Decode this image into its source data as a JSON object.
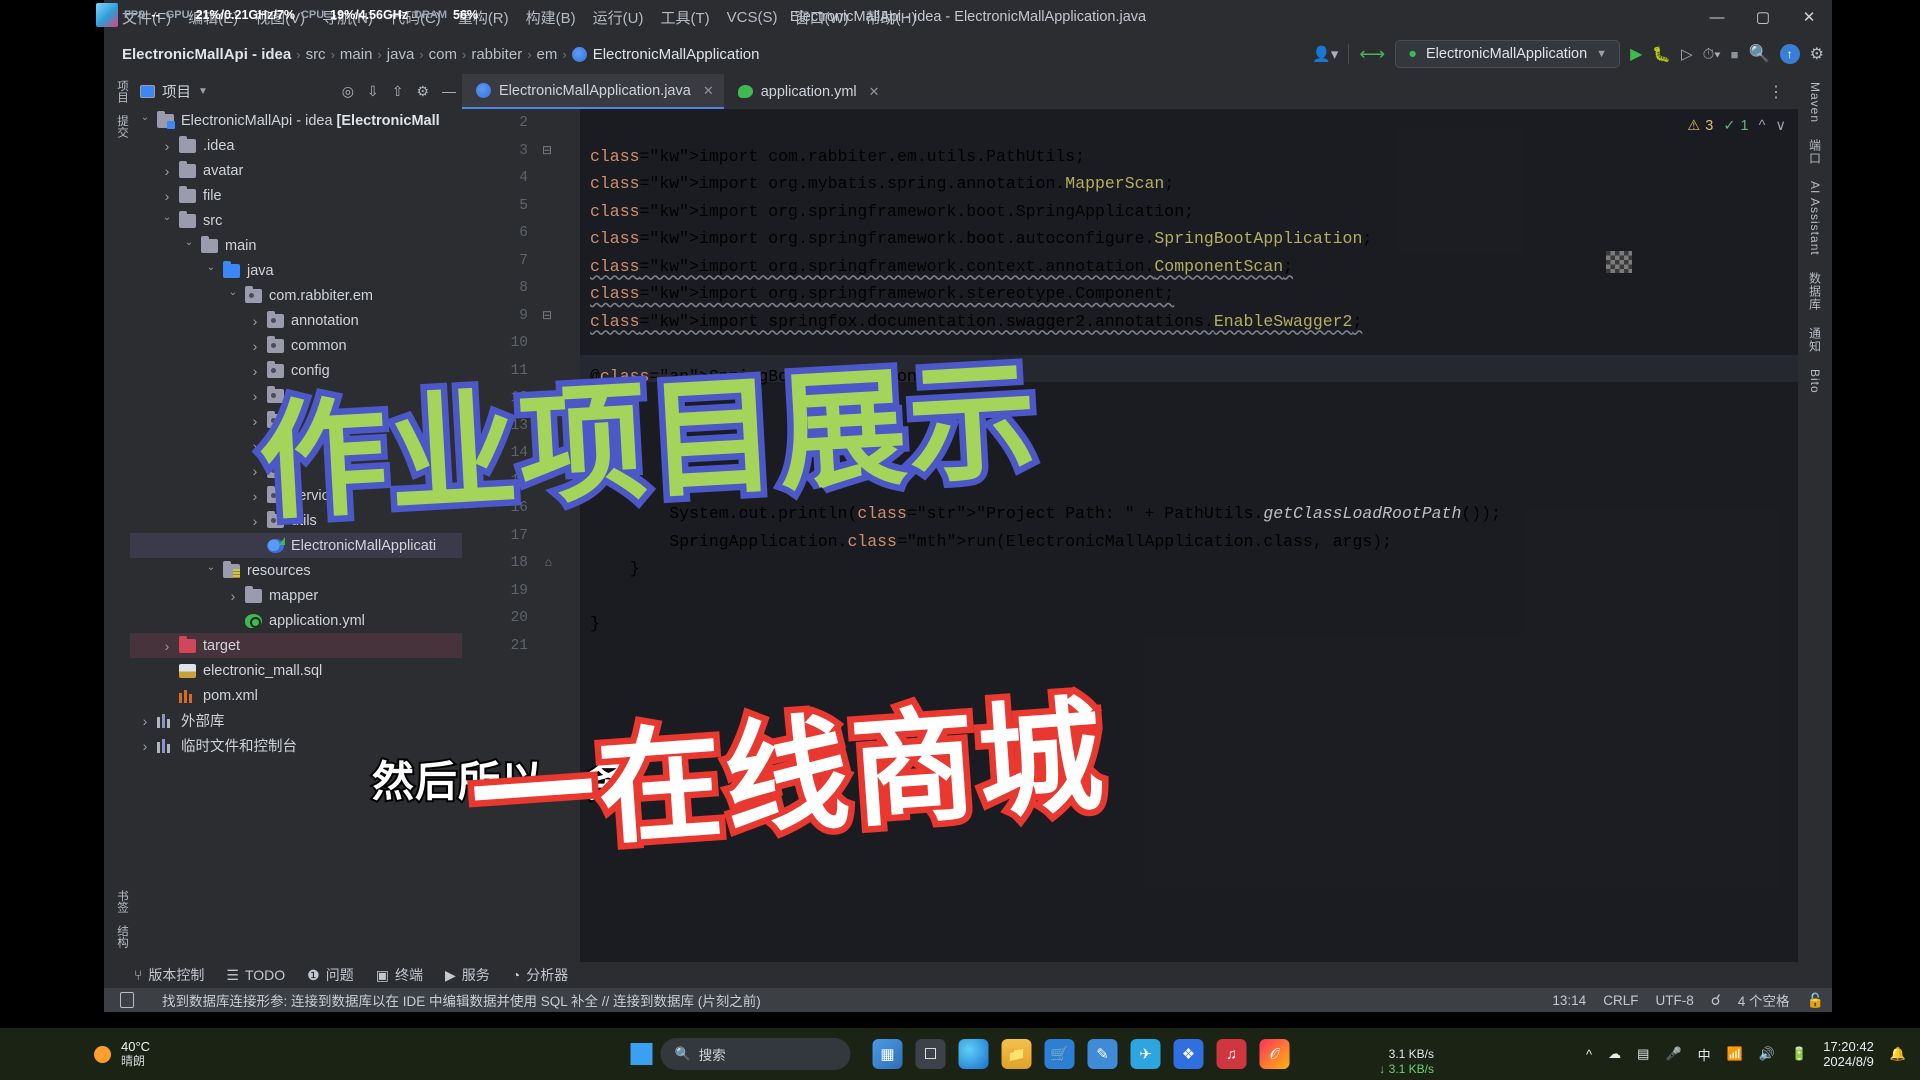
{
  "window": {
    "title": "ElectronicMallApi - idea - ElectronicMallApplication.java",
    "minimize": "—",
    "maximize": "▢",
    "close": "✕"
  },
  "fps_overlay": {
    "fps_label": "FPS",
    "fps_value": "--",
    "gpu_label": "GPU",
    "gpu_value": "21%/0.21GHz/7%",
    "cpu_label": "CPU",
    "cpu_value": "19%/4.56GHz",
    "dram_label": "DRAM",
    "dram_value": "56%"
  },
  "menu": [
    {
      "label": "文件(F)"
    },
    {
      "label": "编辑(E)"
    },
    {
      "label": "视图(V)"
    },
    {
      "label": "导航(N)"
    },
    {
      "label": "代码(C)"
    },
    {
      "label": "重构(R)"
    },
    {
      "label": "构建(B)"
    },
    {
      "label": "运行(U)"
    },
    {
      "label": "工具(T)"
    },
    {
      "label": "VCS(S)"
    },
    {
      "label": "窗口(W)"
    },
    {
      "label": "帮助(H)"
    }
  ],
  "breadcrumb": {
    "project": "ElectronicMallApi - idea",
    "parts": [
      "src",
      "main",
      "java",
      "com",
      "rabbiter",
      "em"
    ],
    "file": "ElectronicMallApplication"
  },
  "navbar": {
    "run_config": "ElectronicMallApplication",
    "run_tooltip": "运行",
    "debug_tooltip": "调试",
    "search_tooltip": "搜索",
    "settings_tooltip": "设置"
  },
  "left_strip": [
    {
      "label": "项目"
    },
    {
      "label": "提交"
    }
  ],
  "right_strip": [
    {
      "label": "Maven"
    },
    {
      "label": "端口"
    },
    {
      "label": "AI Assistant"
    },
    {
      "label": "数据库"
    },
    {
      "label": "通知"
    },
    {
      "label": "Bito"
    }
  ],
  "project_panel": {
    "title": "项目",
    "icons": [
      "target-icon",
      "collapse-icon",
      "expand-icon",
      "settings-icon",
      "minimize-icon"
    ],
    "tree": [
      {
        "depth": 0,
        "arrow": "down",
        "icon": "module",
        "label": "ElectronicMallApi - idea ",
        "bold": "[ElectronicMall"
      },
      {
        "depth": 1,
        "arrow": "right",
        "icon": "folder",
        "label": ".idea"
      },
      {
        "depth": 1,
        "arrow": "right",
        "icon": "folder",
        "label": "avatar"
      },
      {
        "depth": 1,
        "arrow": "right",
        "icon": "folder",
        "label": "file"
      },
      {
        "depth": 1,
        "arrow": "down",
        "icon": "folder",
        "label": "src"
      },
      {
        "depth": 2,
        "arrow": "down",
        "icon": "folder",
        "label": "main"
      },
      {
        "depth": 3,
        "arrow": "down",
        "icon": "folder-blue",
        "label": "java"
      },
      {
        "depth": 4,
        "arrow": "down",
        "icon": "package",
        "label": "com.rabbiter.em"
      },
      {
        "depth": 5,
        "arrow": "right",
        "icon": "package",
        "label": "annotation"
      },
      {
        "depth": 5,
        "arrow": "right",
        "icon": "package",
        "label": "common"
      },
      {
        "depth": 5,
        "arrow": "right",
        "icon": "package",
        "label": "config"
      },
      {
        "depth": 5,
        "arrow": "right",
        "icon": "package",
        "label": ""
      },
      {
        "depth": 5,
        "arrow": "right",
        "icon": "package",
        "label": ""
      },
      {
        "depth": 5,
        "arrow": "right",
        "icon": "package",
        "label": ""
      },
      {
        "depth": 5,
        "arrow": "right",
        "icon": "package",
        "label": ""
      },
      {
        "depth": 5,
        "arrow": "right",
        "icon": "package",
        "label": "service"
      },
      {
        "depth": 5,
        "arrow": "right",
        "icon": "package",
        "label": "utils"
      },
      {
        "depth": 5,
        "arrow": "none",
        "icon": "java",
        "label": "ElectronicMallApplicati",
        "selected": true
      },
      {
        "depth": 3,
        "arrow": "down",
        "icon": "resources",
        "label": "resources"
      },
      {
        "depth": 4,
        "arrow": "right",
        "icon": "folder",
        "label": "mapper"
      },
      {
        "depth": 4,
        "arrow": "none",
        "icon": "yml",
        "label": "application.yml"
      },
      {
        "depth": 1,
        "arrow": "right",
        "icon": "folder-red",
        "label": "target",
        "target": true
      },
      {
        "depth": 1,
        "arrow": "none",
        "icon": "sql",
        "label": "electronic_mall.sql"
      },
      {
        "depth": 1,
        "arrow": "none",
        "icon": "maven",
        "label": "pom.xml"
      },
      {
        "depth": 0,
        "arrow": "right",
        "icon": "library",
        "label": "外部库"
      },
      {
        "depth": 0,
        "arrow": "right",
        "icon": "library",
        "label": "临时文件和控制台"
      }
    ]
  },
  "editor": {
    "tabs": [
      {
        "label": "ElectronicMallApplication.java",
        "icon": "java-icon",
        "active": true,
        "close": "✕"
      },
      {
        "label": "application.yml",
        "icon": "yml-icon",
        "active": false,
        "close": "✕"
      }
    ],
    "more": "⋮",
    "inspections": {
      "warning_count": "3",
      "warning_icon": "⚠",
      "ok_count": "1",
      "ok_icon": "✓",
      "prev": "⌃",
      "next": "⌄"
    },
    "lines": [
      {
        "num": "2",
        "text": ""
      },
      {
        "num": "3",
        "text": "import com.rabbiter.em.utils.PathUtils;"
      },
      {
        "num": "4",
        "text": "import org.mybatis.spring.annotation.MapperScan;"
      },
      {
        "num": "5",
        "text": "import org.springframework.boot.SpringApplication;"
      },
      {
        "num": "6",
        "text": "import org.springframework.boot.autoconfigure.SpringBootApplication;"
      },
      {
        "num": "7",
        "text": "import org.springframework.context.annotation.ComponentScan;"
      },
      {
        "num": "8",
        "text": "import org.springframework.stereotype.Component;"
      },
      {
        "num": "9",
        "text": "import springfox.documentation.swagger2.annotations.EnableSwagger2;"
      },
      {
        "num": "10",
        "text": ""
      },
      {
        "num": "11",
        "text": "@SpringBootApplication"
      },
      {
        "num": "12",
        "text": ""
      },
      {
        "num": "13",
        "text": ""
      },
      {
        "num": "14",
        "text": ""
      },
      {
        "num": "15",
        "text": ""
      },
      {
        "num": "16",
        "text": "        System.out.println(\"Project Path: \" + PathUtils.getClassLoadRootPath());"
      },
      {
        "num": "17",
        "text": "        SpringApplication.run(ElectronicMallApplication.class, args);"
      },
      {
        "num": "18",
        "text": "    }"
      },
      {
        "num": "19",
        "text": ""
      },
      {
        "num": "20",
        "text": "}"
      },
      {
        "num": "21",
        "text": ""
      }
    ]
  },
  "bottom_bar": [
    {
      "icon": "branch-icon",
      "label": "版本控制"
    },
    {
      "icon": "list-icon",
      "label": "TODO"
    },
    {
      "icon": "warning-icon",
      "label": "问题"
    },
    {
      "icon": "terminal-icon",
      "label": "终端"
    },
    {
      "icon": "services-icon",
      "label": "服务"
    },
    {
      "icon": "profiler-icon",
      "label": "分析器"
    }
  ],
  "status_bar": {
    "icon": "notification-icon",
    "message": "找到数据库连接形参: 连接到数据库以在 IDE 中编辑数据并使用 SQL 补全 // 连接到数据库 (片刻之前)",
    "position": "13:14",
    "line_sep": "CRLF",
    "encoding": "UTF-8",
    "inspection": "检查",
    "indent": "4 个空格",
    "lock": "🔓"
  },
  "overlays": {
    "title": "作业项目展示",
    "subtitle": "一在线商城",
    "caption": "然后所以…务"
  },
  "taskbar": {
    "temperature": "40°C",
    "weather": "晴朗",
    "search_placeholder": "搜索",
    "apps": [
      {
        "name": "widgets-icon"
      },
      {
        "name": "search-icon"
      },
      {
        "name": "taskview-icon"
      },
      {
        "name": "edge-icon"
      },
      {
        "name": "explorer-icon"
      },
      {
        "name": "notes-icon"
      },
      {
        "name": "store-icon"
      },
      {
        "name": "music-icon"
      },
      {
        "name": "telegram-icon"
      },
      {
        "name": "feishu-icon"
      },
      {
        "name": "wps-icon"
      },
      {
        "name": "idea-icon"
      }
    ],
    "net_up": "3.1 KB/s",
    "net_down": "3.1 KB/s",
    "tray": [
      "chevron-up-icon",
      "cloud-icon",
      "battery-saver-icon",
      "microphone-icon",
      "ime-icon",
      "wifi-icon",
      "volume-icon",
      "battery-icon"
    ],
    "clock_time": "17:20:42",
    "clock_date": "2024/8/9",
    "bell": "notification-bell-icon"
  },
  "colors": {
    "accent": "#4a88e0",
    "green": "#3fb950",
    "overlay_title": "#a4d45a",
    "overlay_title_stroke": "#4c57c8",
    "overlay_sub_stroke": "#e8382f",
    "ide_bg": "#2b2d30",
    "editor_bg": "#1e1f22"
  }
}
